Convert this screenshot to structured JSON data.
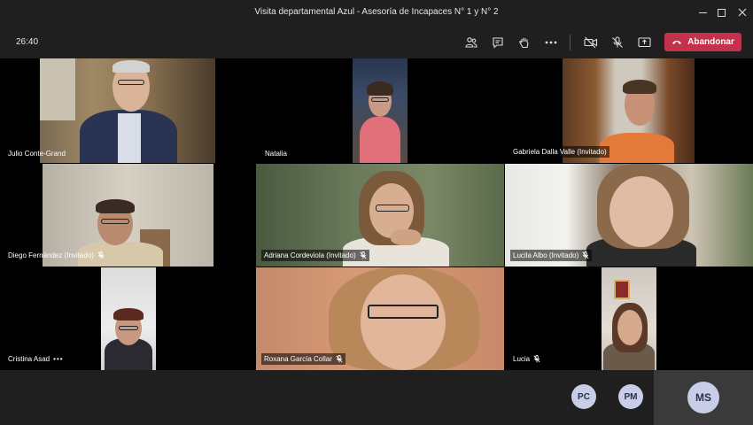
{
  "window": {
    "title": "Visita departamental Azul - Asesoría de Incapaces N° 1 y N° 2"
  },
  "toolbar": {
    "timer": "26:40",
    "leave_label": "Abandonar"
  },
  "participants": [
    {
      "name": "Julio Conte-Grand",
      "mic": "",
      "extra": ""
    },
    {
      "name": "Natalia",
      "mic": "",
      "extra": ""
    },
    {
      "name": "Gabriela Dalla Valle (Invitado)",
      "mic": "",
      "extra": ""
    },
    {
      "name": "Diego Fernández (Invitado)",
      "mic": "muted",
      "extra": ""
    },
    {
      "name": "Adriana Cordeviola (Invitado)",
      "mic": "muted",
      "extra": ""
    },
    {
      "name": "Lucila Albo (Invitado)",
      "mic": "muted",
      "extra": ""
    },
    {
      "name": "Cristina Asad",
      "mic": "",
      "extra": "•••"
    },
    {
      "name": "Roxana García Collar",
      "mic": "muted",
      "extra": ""
    },
    {
      "name": "Lucia",
      "mic": "muted",
      "extra": ""
    }
  ],
  "bottom_avatars": [
    {
      "initials": "PC"
    },
    {
      "initials": "PM"
    },
    {
      "initials": "MS"
    }
  ],
  "colors": {
    "background": "#1f1f1f",
    "leave_button": "#c4314b",
    "avatar": "#c8cde8"
  }
}
